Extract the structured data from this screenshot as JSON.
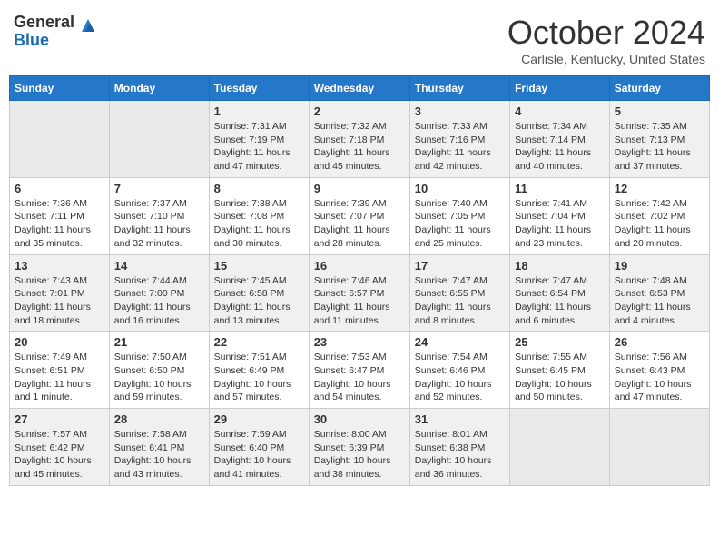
{
  "header": {
    "logo": {
      "general": "General",
      "blue": "Blue"
    },
    "title": "October 2024",
    "location": "Carlisle, Kentucky, United States"
  },
  "weekdays": [
    "Sunday",
    "Monday",
    "Tuesday",
    "Wednesday",
    "Thursday",
    "Friday",
    "Saturday"
  ],
  "weeks": [
    [
      {
        "day": "",
        "info": ""
      },
      {
        "day": "",
        "info": ""
      },
      {
        "day": "1",
        "info": "Sunrise: 7:31 AM\nSunset: 7:19 PM\nDaylight: 11 hours and 47 minutes."
      },
      {
        "day": "2",
        "info": "Sunrise: 7:32 AM\nSunset: 7:18 PM\nDaylight: 11 hours and 45 minutes."
      },
      {
        "day": "3",
        "info": "Sunrise: 7:33 AM\nSunset: 7:16 PM\nDaylight: 11 hours and 42 minutes."
      },
      {
        "day": "4",
        "info": "Sunrise: 7:34 AM\nSunset: 7:14 PM\nDaylight: 11 hours and 40 minutes."
      },
      {
        "day": "5",
        "info": "Sunrise: 7:35 AM\nSunset: 7:13 PM\nDaylight: 11 hours and 37 minutes."
      }
    ],
    [
      {
        "day": "6",
        "info": "Sunrise: 7:36 AM\nSunset: 7:11 PM\nDaylight: 11 hours and 35 minutes."
      },
      {
        "day": "7",
        "info": "Sunrise: 7:37 AM\nSunset: 7:10 PM\nDaylight: 11 hours and 32 minutes."
      },
      {
        "day": "8",
        "info": "Sunrise: 7:38 AM\nSunset: 7:08 PM\nDaylight: 11 hours and 30 minutes."
      },
      {
        "day": "9",
        "info": "Sunrise: 7:39 AM\nSunset: 7:07 PM\nDaylight: 11 hours and 28 minutes."
      },
      {
        "day": "10",
        "info": "Sunrise: 7:40 AM\nSunset: 7:05 PM\nDaylight: 11 hours and 25 minutes."
      },
      {
        "day": "11",
        "info": "Sunrise: 7:41 AM\nSunset: 7:04 PM\nDaylight: 11 hours and 23 minutes."
      },
      {
        "day": "12",
        "info": "Sunrise: 7:42 AM\nSunset: 7:02 PM\nDaylight: 11 hours and 20 minutes."
      }
    ],
    [
      {
        "day": "13",
        "info": "Sunrise: 7:43 AM\nSunset: 7:01 PM\nDaylight: 11 hours and 18 minutes."
      },
      {
        "day": "14",
        "info": "Sunrise: 7:44 AM\nSunset: 7:00 PM\nDaylight: 11 hours and 16 minutes."
      },
      {
        "day": "15",
        "info": "Sunrise: 7:45 AM\nSunset: 6:58 PM\nDaylight: 11 hours and 13 minutes."
      },
      {
        "day": "16",
        "info": "Sunrise: 7:46 AM\nSunset: 6:57 PM\nDaylight: 11 hours and 11 minutes."
      },
      {
        "day": "17",
        "info": "Sunrise: 7:47 AM\nSunset: 6:55 PM\nDaylight: 11 hours and 8 minutes."
      },
      {
        "day": "18",
        "info": "Sunrise: 7:47 AM\nSunset: 6:54 PM\nDaylight: 11 hours and 6 minutes."
      },
      {
        "day": "19",
        "info": "Sunrise: 7:48 AM\nSunset: 6:53 PM\nDaylight: 11 hours and 4 minutes."
      }
    ],
    [
      {
        "day": "20",
        "info": "Sunrise: 7:49 AM\nSunset: 6:51 PM\nDaylight: 11 hours and 1 minute."
      },
      {
        "day": "21",
        "info": "Sunrise: 7:50 AM\nSunset: 6:50 PM\nDaylight: 10 hours and 59 minutes."
      },
      {
        "day": "22",
        "info": "Sunrise: 7:51 AM\nSunset: 6:49 PM\nDaylight: 10 hours and 57 minutes."
      },
      {
        "day": "23",
        "info": "Sunrise: 7:53 AM\nSunset: 6:47 PM\nDaylight: 10 hours and 54 minutes."
      },
      {
        "day": "24",
        "info": "Sunrise: 7:54 AM\nSunset: 6:46 PM\nDaylight: 10 hours and 52 minutes."
      },
      {
        "day": "25",
        "info": "Sunrise: 7:55 AM\nSunset: 6:45 PM\nDaylight: 10 hours and 50 minutes."
      },
      {
        "day": "26",
        "info": "Sunrise: 7:56 AM\nSunset: 6:43 PM\nDaylight: 10 hours and 47 minutes."
      }
    ],
    [
      {
        "day": "27",
        "info": "Sunrise: 7:57 AM\nSunset: 6:42 PM\nDaylight: 10 hours and 45 minutes."
      },
      {
        "day": "28",
        "info": "Sunrise: 7:58 AM\nSunset: 6:41 PM\nDaylight: 10 hours and 43 minutes."
      },
      {
        "day": "29",
        "info": "Sunrise: 7:59 AM\nSunset: 6:40 PM\nDaylight: 10 hours and 41 minutes."
      },
      {
        "day": "30",
        "info": "Sunrise: 8:00 AM\nSunset: 6:39 PM\nDaylight: 10 hours and 38 minutes."
      },
      {
        "day": "31",
        "info": "Sunrise: 8:01 AM\nSunset: 6:38 PM\nDaylight: 10 hours and 36 minutes."
      },
      {
        "day": "",
        "info": ""
      },
      {
        "day": "",
        "info": ""
      }
    ]
  ]
}
